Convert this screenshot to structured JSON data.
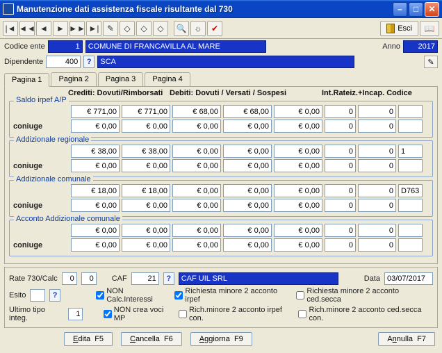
{
  "window": {
    "title": "Manutenzione dati assistenza fiscale risultante dal 730"
  },
  "toolbar": {
    "esci_label": "Esci"
  },
  "header": {
    "codice_ente_label": "Codice ente",
    "codice_ente_value": "1",
    "ente_nome": "COMUNE DI FRANCAVILLA AL MARE",
    "anno_label": "Anno",
    "anno_value": "2017",
    "dipendente_label": "Dipendente",
    "dipendente_value": "400",
    "dipendente_nome": "SCA"
  },
  "tabs": [
    "Pagina 1",
    "Pagina 2",
    "Pagina 3",
    "Pagina 4"
  ],
  "columns": {
    "c1": "Crediti: Dovuti/Rimborsati",
    "c2": "Debiti: Dovuti  /  Versati  /   Sospesi",
    "c3": "Int.Rateiz.+Incap. Codice"
  },
  "groups": {
    "saldo": {
      "legend": "Saldo irpef A/P",
      "coniuge_label": "coniuge",
      "r1": {
        "a": "€ 771,00",
        "b": "€ 771,00",
        "c": "€ 68,00",
        "d": "€ 68,00",
        "e": "€ 0,00",
        "f": "0",
        "g": "0",
        "h": ""
      },
      "r2": {
        "a": "€ 0,00",
        "b": "€ 0,00",
        "c": "€ 0,00",
        "d": "€ 0,00",
        "e": "€ 0,00",
        "f": "0",
        "g": "0",
        "h": ""
      }
    },
    "addreg": {
      "legend": "Addizionale regionale",
      "coniuge_label": "coniuge",
      "r1": {
        "a": "€ 38,00",
        "b": "€ 38,00",
        "c": "€ 0,00",
        "d": "€ 0,00",
        "e": "€ 0,00",
        "f": "0",
        "g": "0",
        "h": "1"
      },
      "r2": {
        "a": "€ 0,00",
        "b": "€ 0,00",
        "c": "€ 0,00",
        "d": "€ 0,00",
        "e": "€ 0,00",
        "f": "0",
        "g": "0",
        "h": ""
      }
    },
    "addcom": {
      "legend": "Addizionale comunale",
      "coniuge_label": "coniuge",
      "r1": {
        "a": "€ 18,00",
        "b": "€ 18,00",
        "c": "€ 0,00",
        "d": "€ 0,00",
        "e": "€ 0,00",
        "f": "0",
        "g": "0",
        "h": "D763"
      },
      "r2": {
        "a": "€ 0,00",
        "b": "€ 0,00",
        "c": "€ 0,00",
        "d": "€ 0,00",
        "e": "€ 0,00",
        "f": "0",
        "g": "0",
        "h": ""
      }
    },
    "acconto": {
      "legend": "Acconto Addizionale comunale",
      "coniuge_label": "coniuge",
      "r1": {
        "a": "€ 0,00",
        "b": "€ 0,00",
        "c": "€ 0,00",
        "d": "€ 0,00",
        "e": "€ 0,00",
        "f": "0",
        "g": "0",
        "h": ""
      },
      "r2": {
        "a": "€ 0,00",
        "b": "€ 0,00",
        "c": "€ 0,00",
        "d": "€ 0,00",
        "e": "€ 0,00",
        "f": "0",
        "g": "0",
        "h": ""
      }
    }
  },
  "bottom": {
    "rate_label": "Rate 730/Calc",
    "rate_a": "0",
    "rate_b": "0",
    "caf_label": "CAF",
    "caf_value": "21",
    "caf_nome": "CAF UIL SRL",
    "data_label": "Data",
    "data_value": "03/07/2017",
    "esito_label": "Esito",
    "esito_value": "",
    "ultimo_label": "Ultimo tipo integ.",
    "ultimo_value": "1",
    "ck_non_calc": "NON Calc.Interessi",
    "ck_rich_min_irpef": "Richiesta minore 2 acconto irpef",
    "ck_rich_min_ced": "Richiesta minore 2 acconto ced.secca",
    "ck_non_crea": "NON crea voci MP",
    "ck_rich_min_irpef_con": "Rich.minore 2 acconto irpef con.",
    "ck_rich_min_ced_con": "Rich.minore 2 acconto ced.secca con."
  },
  "buttons": {
    "edita": "Edita  F5",
    "cancella": "Cancella  F6",
    "aggiorna": "Aggiorna  F9",
    "annulla": "Annulla  F7"
  }
}
